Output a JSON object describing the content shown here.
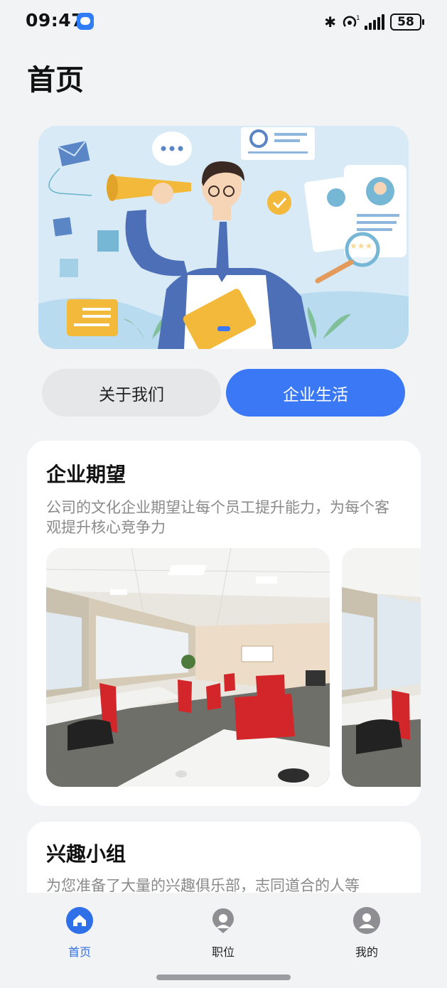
{
  "status_bar": {
    "time": "09:47",
    "battery": "58",
    "hotspot_badge": "1"
  },
  "page": {
    "title": "首页"
  },
  "tabs": [
    {
      "label": "关于我们",
      "active": false
    },
    {
      "label": "企业生活",
      "active": true
    }
  ],
  "sections": [
    {
      "title": "企业期望",
      "description": "公司的文化企业期望让每个员工提升能力，为每个客观提升核心竞争力"
    },
    {
      "title": "兴趣小组",
      "description": "为您准备了大量的兴趣俱乐部，志同道合的人等"
    }
  ],
  "bottom_nav": [
    {
      "label": "首页",
      "icon": "home-icon",
      "active": true
    },
    {
      "label": "职位",
      "icon": "location-pin-icon",
      "active": false
    },
    {
      "label": "我的",
      "icon": "user-icon",
      "active": false
    }
  ],
  "colors": {
    "accent": "#3a78f5",
    "background": "#f1f3f5",
    "card": "#ffffff",
    "muted_text": "#8a8a8a"
  }
}
